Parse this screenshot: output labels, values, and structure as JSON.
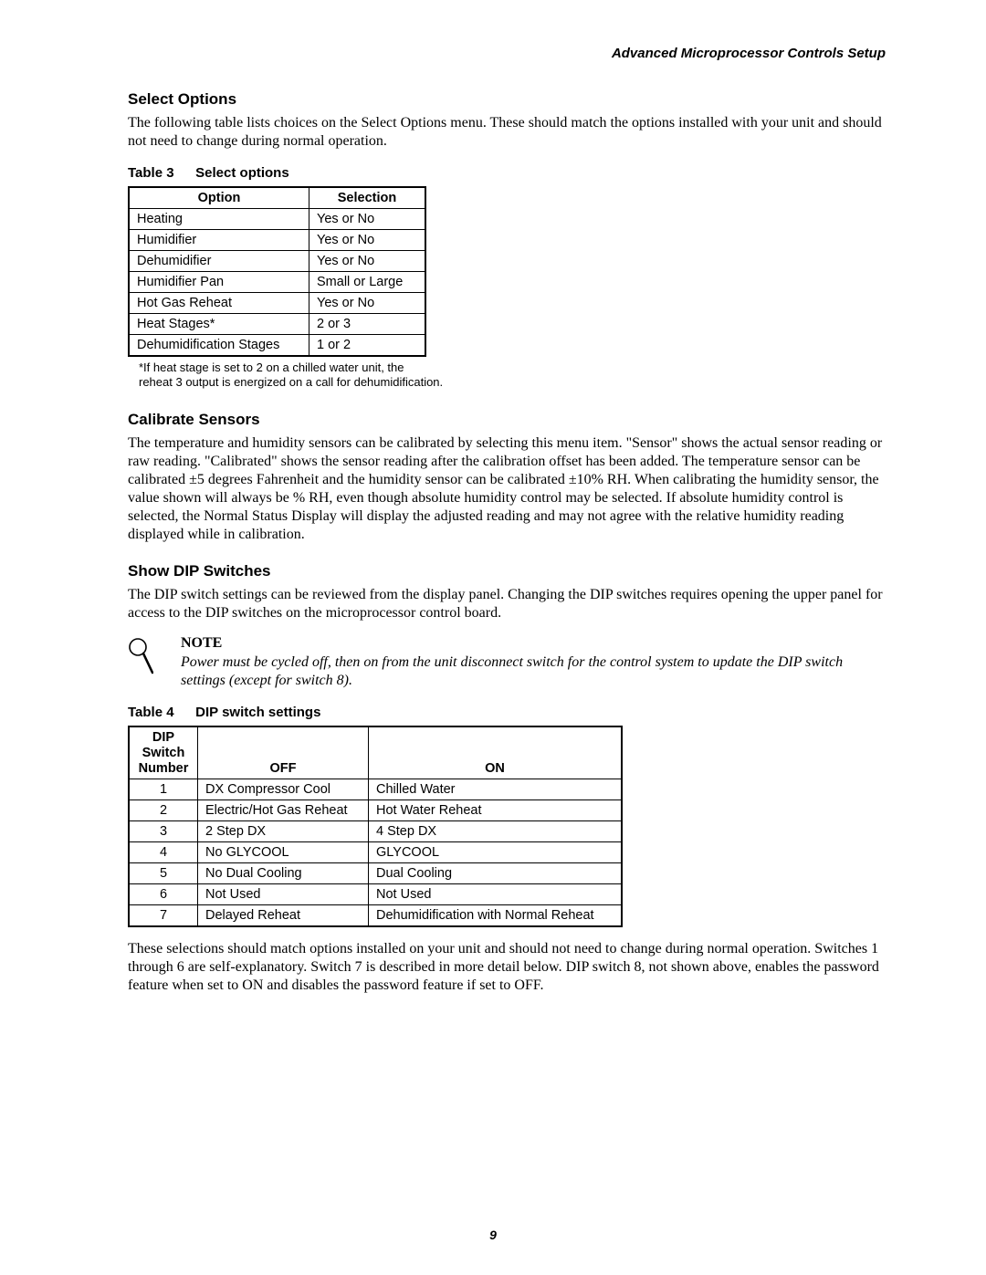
{
  "running_head": "Advanced Microprocessor Controls Setup",
  "sec1": {
    "title": "Select Options",
    "para": "The following table lists choices on the Select Options menu. These should match the options installed with your unit and should not need to change during normal operation.",
    "table_caption_label": "Table 3",
    "table_caption_title": "Select options",
    "headers": {
      "c1": "Option",
      "c2": "Selection"
    },
    "rows": [
      {
        "c1": "Heating",
        "c2": "Yes or No"
      },
      {
        "c1": "Humidifier",
        "c2": "Yes or No"
      },
      {
        "c1": "Dehumidifier",
        "c2": "Yes or No"
      },
      {
        "c1": "Humidifier Pan",
        "c2": "Small or Large"
      },
      {
        "c1": "Hot Gas Reheat",
        "c2": "Yes or No"
      },
      {
        "c1": "Heat Stages*",
        "c2": "2 or 3"
      },
      {
        "c1": "Dehumidification Stages",
        "c2": "1 or 2"
      }
    ],
    "footnote_l1": "*If heat stage is set to 2 on a chilled water unit, the",
    "footnote_l2": "reheat 3 output is energized on a call for dehumidification."
  },
  "sec2": {
    "title": "Calibrate Sensors",
    "para": "The temperature and humidity sensors can be calibrated by selecting this menu item. \"Sensor\" shows the actual sensor reading or raw reading. \"Calibrated\" shows the sensor reading after the calibration offset has been added. The temperature sensor can be calibrated ±5 degrees Fahrenheit and the humidity sensor can be calibrated ±10% RH. When calibrating the humidity sensor, the value shown will always be % RH, even though absolute humidity control may be selected. If absolute humidity control is selected, the Normal Status Display will display the adjusted reading and may not agree with the relative humidity reading displayed while in calibration."
  },
  "sec3": {
    "title": "Show DIP Switches",
    "para": "The DIP switch settings can be reviewed from the display panel. Changing the DIP switches requires opening the upper panel for access to the DIP switches on the microprocessor control board.",
    "note_title": "NOTE",
    "note_body": "Power must be cycled off, then on from the unit disconnect switch for the control system to update the DIP switch settings (except for switch 8).",
    "table_caption_label": "Table 4",
    "table_caption_title": "DIP switch settings",
    "headers": {
      "c1a": "DIP",
      "c1b": "Switch",
      "c1c": "Number",
      "c2": "OFF",
      "c3": "ON"
    },
    "rows": [
      {
        "c1": "1",
        "c2": "DX Compressor Cool",
        "c3": "Chilled Water"
      },
      {
        "c1": "2",
        "c2": "Electric/Hot Gas Reheat",
        "c3": "Hot Water Reheat"
      },
      {
        "c1": "3",
        "c2": "2 Step DX",
        "c3": "4 Step DX"
      },
      {
        "c1": "4",
        "c2": "No GLYCOOL",
        "c3": "GLYCOOL"
      },
      {
        "c1": "5",
        "c2": "No Dual Cooling",
        "c3": "Dual Cooling"
      },
      {
        "c1": "6",
        "c2": "Not Used",
        "c3": "Not Used"
      },
      {
        "c1": "7",
        "c2": "Delayed Reheat",
        "c3": "Dehumidification with Normal Reheat"
      }
    ],
    "para2": "These selections should match options installed on your unit and should not need to change during normal operation. Switches 1 through 6 are self-explanatory. Switch 7 is described in more detail below. DIP switch 8, not shown above, enables the password feature when set to ON and disables the password feature if set to OFF."
  },
  "page_number": "9"
}
